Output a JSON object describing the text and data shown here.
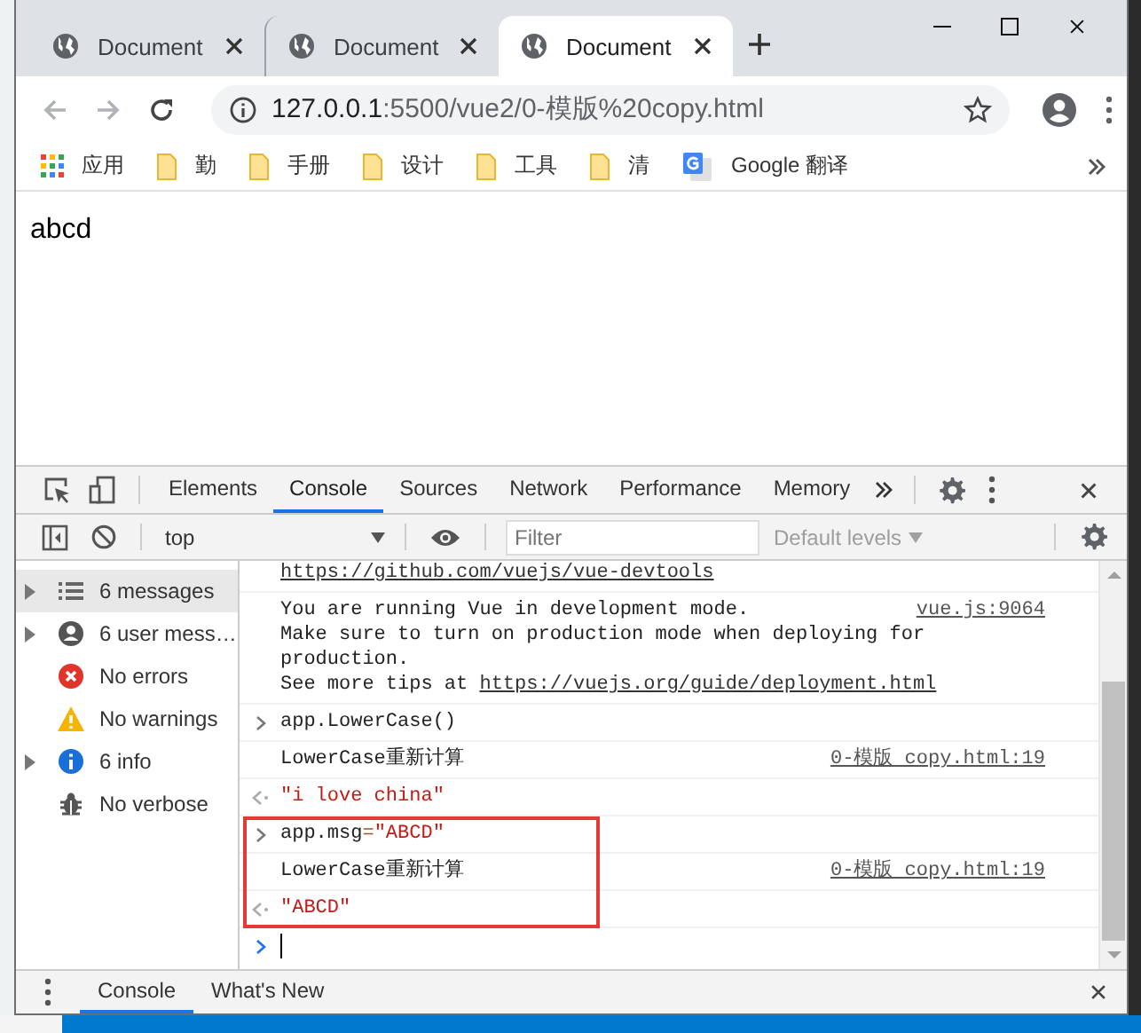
{
  "browser": {
    "tabs": [
      {
        "title": "Document",
        "selected": false
      },
      {
        "title": "Document",
        "selected": false
      },
      {
        "title": "Document",
        "selected": true
      }
    ],
    "address": {
      "host": "127.0.0.1",
      "path": ":5500/vue2/0-模版%20copy.html"
    },
    "bookmarks": [
      {
        "kind": "apps",
        "label": "应用"
      },
      {
        "kind": "folder",
        "label": "勤"
      },
      {
        "kind": "folder",
        "label": "手册"
      },
      {
        "kind": "folder",
        "label": "设计"
      },
      {
        "kind": "folder",
        "label": "工具"
      },
      {
        "kind": "folder",
        "label": "清"
      },
      {
        "kind": "translate",
        "label": "Google 翻译"
      }
    ]
  },
  "page": {
    "text": "abcd"
  },
  "devtools": {
    "tabs": [
      {
        "label": "Elements",
        "selected": false
      },
      {
        "label": "Console",
        "selected": true
      },
      {
        "label": "Sources",
        "selected": false
      },
      {
        "label": "Network",
        "selected": false
      },
      {
        "label": "Performance",
        "selected": false
      },
      {
        "label": "Memory",
        "selected": false
      }
    ],
    "context": "top",
    "filter": {
      "placeholder": "Filter"
    },
    "levels": "Default levels",
    "sidebar": [
      {
        "label": "6 messages",
        "expandable": true,
        "selected": true
      },
      {
        "label": "6 user mess…",
        "expandable": true,
        "selected": false
      },
      {
        "label": "No errors",
        "expandable": false,
        "selected": false
      },
      {
        "label": "No warnings",
        "expandable": false,
        "selected": false
      },
      {
        "label": "6 info",
        "expandable": true,
        "selected": false
      },
      {
        "label": "No verbose",
        "expandable": false,
        "selected": false
      }
    ],
    "messages": [
      {
        "kind": "link",
        "text": "https://github.com/vuejs/vue-devtools",
        "highlighted": false
      },
      {
        "kind": "log",
        "lines": [
          "You are running Vue in development mode.",
          "Make sure to turn on production mode when deploying for production.",
          "See more tips at "
        ],
        "link": "https://vuejs.org/guide/deployment.html",
        "source": "vue.js:9064",
        "highlighted": false
      },
      {
        "kind": "input",
        "parts": [
          {
            "kind": "plain",
            "text": "app.LowerCase()"
          }
        ],
        "highlighted": false
      },
      {
        "kind": "log",
        "lines": [
          "LowerCase重新计算"
        ],
        "source": "0-模版 copy.html:19",
        "highlighted": false
      },
      {
        "kind": "output",
        "text": "\"i love china\"",
        "highlighted": false
      },
      {
        "kind": "input",
        "parts": [
          {
            "kind": "plain",
            "text": "app.msg"
          },
          {
            "kind": "operator",
            "text": "="
          },
          {
            "kind": "string",
            "text": "\"ABCD\""
          }
        ],
        "highlighted": true
      },
      {
        "kind": "log",
        "lines": [
          "LowerCase重新计算"
        ],
        "source": "0-模版 copy.html:19",
        "highlighted": true
      },
      {
        "kind": "output",
        "text": "\"ABCD\"",
        "highlighted": true
      },
      {
        "kind": "prompt",
        "highlighted": false
      }
    ]
  },
  "drawer": {
    "tabs": [
      {
        "label": "Console",
        "selected": true
      },
      {
        "label": "What's New",
        "selected": false
      }
    ]
  }
}
